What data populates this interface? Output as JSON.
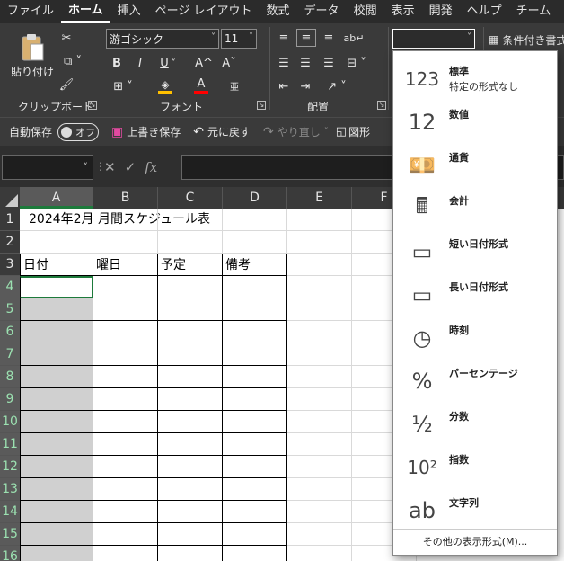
{
  "menubar": {
    "items": [
      "ファイル",
      "ホーム",
      "挿入",
      "ページ レイアウト",
      "数式",
      "データ",
      "校閲",
      "表示",
      "開発",
      "ヘルプ",
      "チーム"
    ],
    "active": 1
  },
  "ribbon": {
    "clipboard": {
      "paste_label": "貼り付け",
      "group_label": "クリップボード"
    },
    "font": {
      "font_name": "游ゴシック",
      "font_size": "11",
      "group_label": "フォント",
      "bold": "B",
      "italic": "I",
      "underline": "U",
      "grow": "A^",
      "shrink": "Aˇ",
      "fill_color": "#ffc000",
      "font_color": "#ff0000"
    },
    "alignment": {
      "group_label": "配置"
    },
    "number_format_value": "",
    "conditional_format_label": "条件付き書式"
  },
  "qat": {
    "autosave_label": "自動保存",
    "autosave_state": "オフ",
    "save_label": "上書き保存",
    "undo_label": "元に戻す",
    "redo_label": "やり直し",
    "shape_label": "図形"
  },
  "formula": {
    "namebox_value": "",
    "formula_value": ""
  },
  "sheet": {
    "columns": [
      "A",
      "B",
      "C",
      "D",
      "E",
      "F"
    ],
    "rows": [
      "1",
      "2",
      "3",
      "4",
      "5",
      "6",
      "7",
      "8",
      "9",
      "10",
      "11",
      "12",
      "13",
      "14",
      "15",
      "16"
    ],
    "title": "2024年2月 月間スケジュール表",
    "headers": [
      "日付",
      "曜日",
      "予定",
      "備考"
    ]
  },
  "dropdown": {
    "items": [
      {
        "icon": "clock-123-icon",
        "glyph": "123",
        "title": "標準",
        "sub": "特定の形式なし"
      },
      {
        "icon": "number-12-icon",
        "glyph": "12",
        "title": "数値",
        "sub": ""
      },
      {
        "icon": "currency-icon",
        "glyph": "💴",
        "title": "通貨",
        "sub": ""
      },
      {
        "icon": "accounting-icon",
        "glyph": "🖩",
        "title": "会計",
        "sub": ""
      },
      {
        "icon": "short-date-icon",
        "glyph": "▭",
        "title": "短い日付形式",
        "sub": ""
      },
      {
        "icon": "long-date-icon",
        "glyph": "▭",
        "title": "長い日付形式",
        "sub": ""
      },
      {
        "icon": "time-clock-icon",
        "glyph": "◷",
        "title": "時刻",
        "sub": ""
      },
      {
        "icon": "percent-icon",
        "glyph": "%",
        "title": "パーセンテージ",
        "sub": ""
      },
      {
        "icon": "fraction-icon",
        "glyph": "½",
        "title": "分数",
        "sub": ""
      },
      {
        "icon": "scientific-icon",
        "glyph": "10²",
        "title": "指数",
        "sub": ""
      },
      {
        "icon": "text-ab-icon",
        "glyph": "ab",
        "title": "文字列",
        "sub": ""
      }
    ],
    "footer": "その他の表示形式(M)..."
  }
}
